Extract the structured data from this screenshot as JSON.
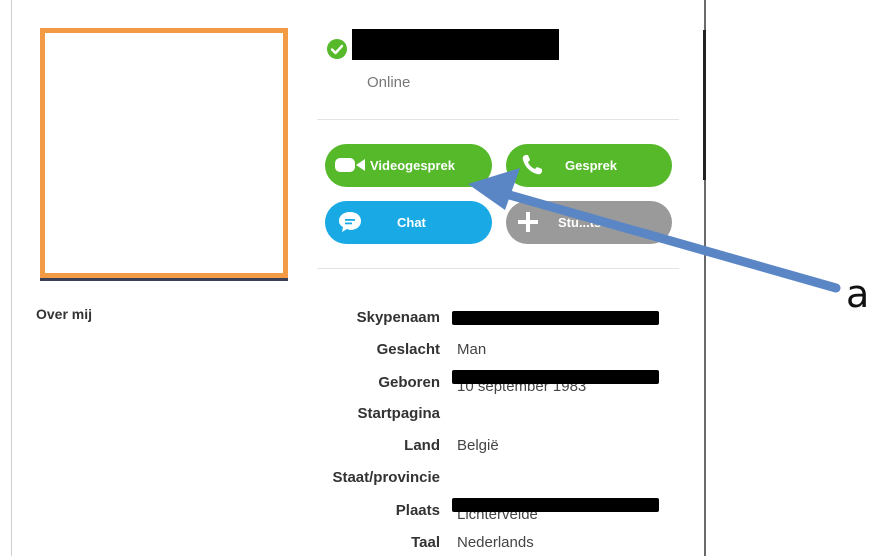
{
  "profile": {
    "about_heading": "Over mij",
    "status": "Online"
  },
  "actions": {
    "video_call": "Videogesprek",
    "call": "Gesprek",
    "chat": "Chat",
    "add_contact": "Stu...ts"
  },
  "details": [
    {
      "key": "Skypenaam",
      "value": ""
    },
    {
      "key": "Geslacht",
      "value": "Man"
    },
    {
      "key": "Geboren",
      "value": "10 september 1983"
    },
    {
      "key": "Startpagina",
      "value": ""
    },
    {
      "key": "Land",
      "value": "België"
    },
    {
      "key": "Staat/provincie",
      "value": ""
    },
    {
      "key": "Plaats",
      "value": "Lichtervelde"
    },
    {
      "key": "Taal",
      "value": "Nederlands"
    }
  ],
  "annotation": {
    "label": "a",
    "color": "#5b86c5"
  },
  "colors": {
    "green": "#55b92a",
    "blue": "#19a9e5",
    "grey": "#9a9a9a",
    "frame": "#f39a44"
  },
  "icons": {
    "status": "check-badge-icon",
    "video_call": "video-camera-icon",
    "call": "phone-icon",
    "chat": "chat-bubble-icon",
    "add_contact": "plus-icon"
  }
}
